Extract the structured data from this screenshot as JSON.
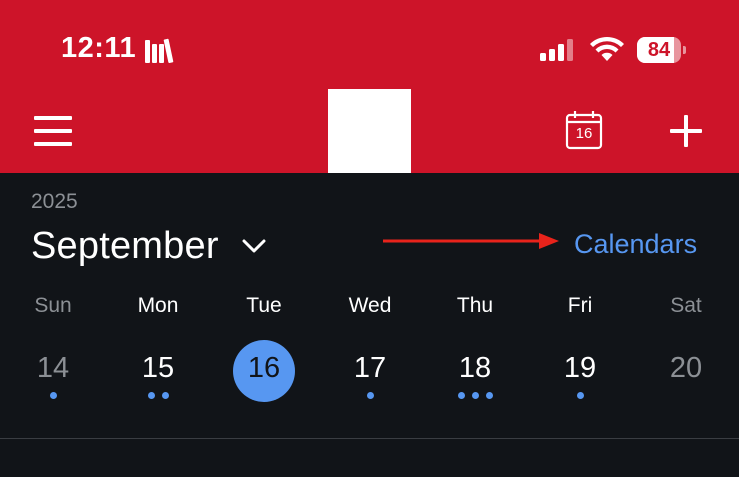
{
  "status_bar": {
    "time": "12:11",
    "battery_percent": "84",
    "battery_level": 0.84
  },
  "header": {
    "menu_icon": "hamburger-menu-icon",
    "today_icon": "calendar-today-icon",
    "today_number": "16",
    "add_icon": "plus-icon",
    "color": "#cd1429"
  },
  "calendar": {
    "year": "2025",
    "month": "September",
    "calendars_link": "Calendars",
    "accent": "#5797f1",
    "weekdays": [
      "Sun",
      "Mon",
      "Tue",
      "Wed",
      "Thu",
      "Fri",
      "Sat"
    ],
    "days": [
      {
        "label": "14",
        "dots": 1,
        "muted": true,
        "selected": false
      },
      {
        "label": "15",
        "dots": 2,
        "muted": false,
        "selected": false
      },
      {
        "label": "16",
        "dots": 0,
        "muted": false,
        "selected": true
      },
      {
        "label": "17",
        "dots": 1,
        "muted": false,
        "selected": false
      },
      {
        "label": "18",
        "dots": 3,
        "muted": false,
        "selected": false
      },
      {
        "label": "19",
        "dots": 1,
        "muted": false,
        "selected": false
      },
      {
        "label": "20",
        "dots": 0,
        "muted": true,
        "selected": false
      }
    ]
  },
  "annotation": {
    "arrow_color": "#e8231b"
  }
}
